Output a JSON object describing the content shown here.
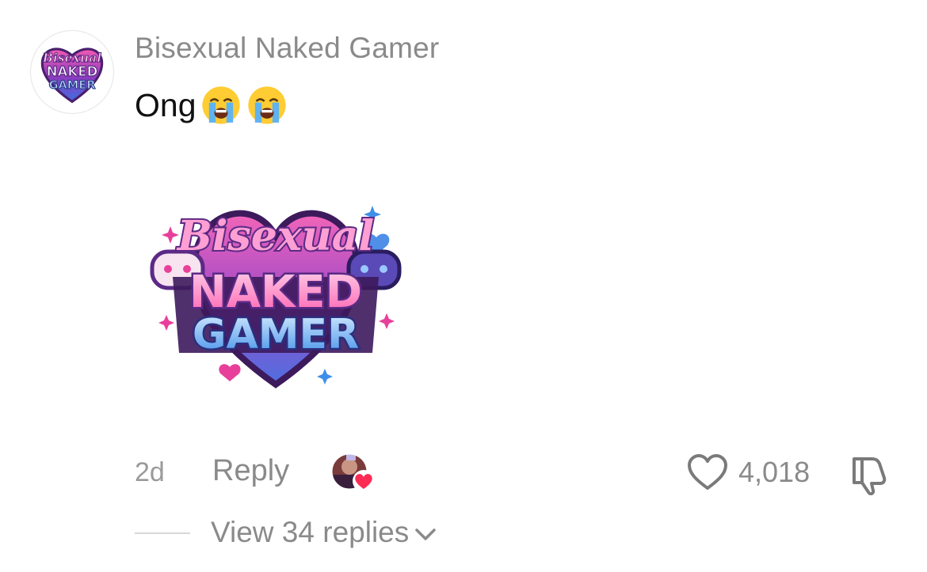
{
  "comment": {
    "username": "Bisexual Naked Gamer",
    "text": "Ong",
    "emojis": [
      "loudly-crying-face-emoji",
      "loudly-crying-face-emoji"
    ],
    "timestamp": "2d",
    "reply_label": "Reply",
    "like_count": "4,018",
    "view_replies_label": "View 34 replies"
  },
  "logo": {
    "line1": "Bisexual",
    "line2": "NAKED",
    "line3": "GAMER"
  },
  "icons": {
    "avatar": "bisexual-naked-gamer-logo",
    "creator_liked": "creator-liked-avatar-with-heart",
    "like": "heart-outline-icon",
    "dislike": "thumbs-down-icon",
    "expand": "chevron-down-icon"
  },
  "colors": {
    "username": "#8a8a8a",
    "text": "#111111",
    "muted": "#8a8a8a",
    "heart_red": "#fe2c55",
    "logo_pink": "#e8409a",
    "logo_purple": "#5b2a86",
    "logo_blue": "#3f8fe8"
  }
}
